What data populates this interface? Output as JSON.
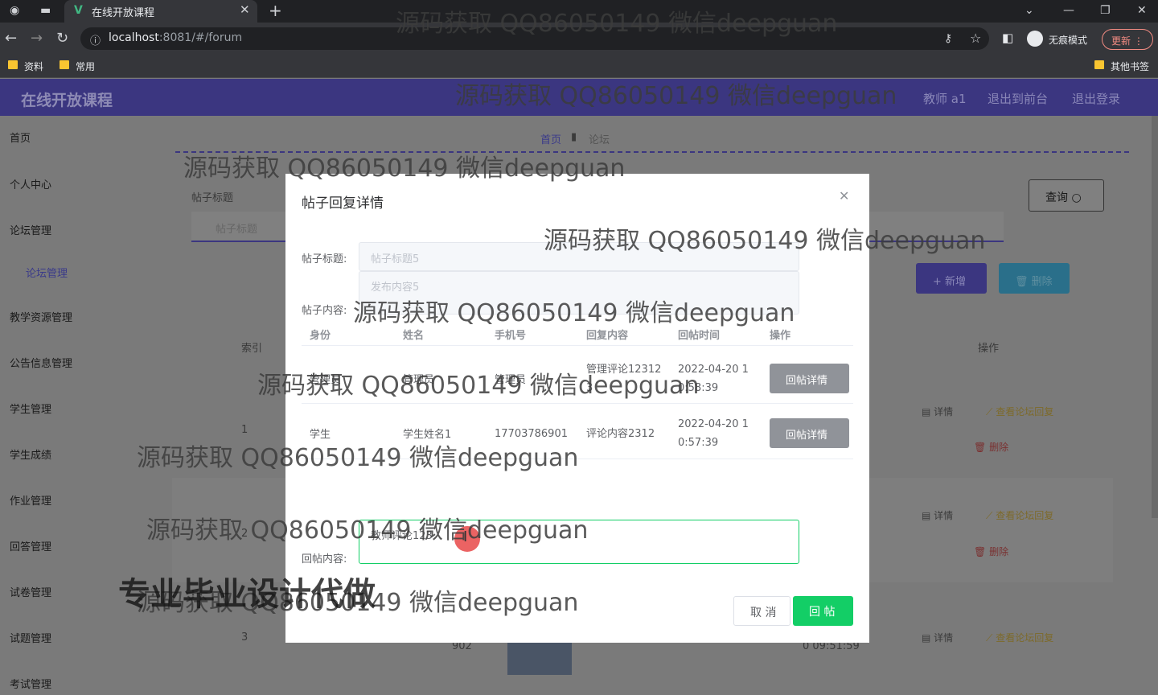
{
  "browser": {
    "tab_title": "在线开放课程",
    "url_host": "localhost",
    "url_rest": ":8081/#/forum",
    "incognito_label": "无痕模式",
    "update_label": "更新",
    "bookmarks": [
      "资料",
      "常用"
    ],
    "other_bookmarks": "其他书签"
  },
  "header": {
    "title": "在线开放课程",
    "user": "教师 a1",
    "back_front": "退出到前台",
    "logout": "退出登录"
  },
  "sidebar": {
    "items": [
      "首页",
      "个人中心",
      "论坛管理",
      "论坛管理",
      "教学资源管理",
      "公告信息管理",
      "学生管理",
      "学生成绩",
      "作业管理",
      "回答管理",
      "试卷管理",
      "试题管理",
      "考试管理"
    ]
  },
  "main": {
    "breadcrumb_home": "首页",
    "breadcrumb_current": "论坛",
    "search_label": "帖子标题",
    "search_placeholder": "帖子标题",
    "query_button": "查询",
    "add_button": "新增",
    "delete_button": "删除",
    "col_index": "索引",
    "col_action": "操作",
    "rows": [
      {
        "index": "1",
        "detail": "详情",
        "view": "查看论坛回复",
        "delete": "删除"
      },
      {
        "index": "2",
        "detail": "详情",
        "view": "查看论坛回复",
        "delete": "删除"
      },
      {
        "index": "3",
        "detail": "详情",
        "view": "查看论坛回复",
        "delete": "删除",
        "num": "902",
        "time": "0 09:51:59"
      }
    ]
  },
  "dialog": {
    "title": "帖子回复详情",
    "post_title_label": "帖子标题:",
    "post_title_value": "帖子标题5",
    "post_content_label": "帖子内容:",
    "post_content_value": "发布内容5",
    "columns": [
      "身份",
      "姓名",
      "手机号",
      "回复内容",
      "回帖时间",
      "操作"
    ],
    "replies": [
      {
        "role": "管理员",
        "name": "管理员",
        "phone": "管理员",
        "content": "管理评论123123",
        "time": "2022-04-20 10:58:39",
        "action": "回帖详情"
      },
      {
        "role": "学生",
        "name": "学生姓名1",
        "phone": "17703786901",
        "content": "评论内容2312",
        "time": "2022-04-20 10:57:39",
        "action": "回帖详情"
      }
    ],
    "reply_label": "回帖内容:",
    "reply_value": "教师评论123",
    "cancel": "取 消",
    "submit": "回 帖"
  },
  "watermarks": [
    "源码获取 QQ86050149 微信deepguan",
    "专业毕业设计代做"
  ]
}
